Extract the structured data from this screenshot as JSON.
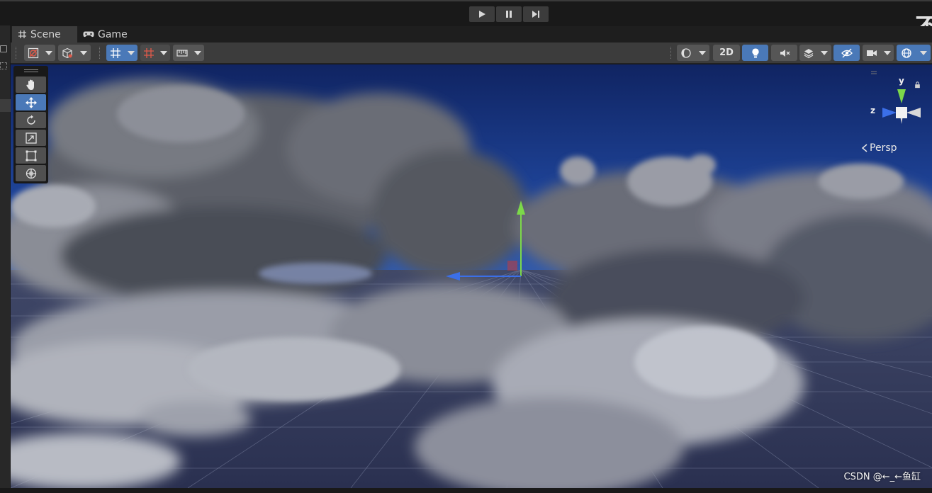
{
  "tabs": [
    {
      "label": "Scene",
      "icon": "grid-icon",
      "active": true
    },
    {
      "label": "Game",
      "icon": "gamepad-icon",
      "active": false
    }
  ],
  "playbar": {
    "buttons": [
      "play-icon",
      "pause-icon",
      "step-icon"
    ],
    "corner_glyph": "不"
  },
  "toolbar": {
    "left_tools": [
      "draw-mode-icon",
      "shading-cube-icon",
      "grid-snap-icon",
      "increment-snap-icon",
      "ruler-icon"
    ],
    "right_tools": [
      "render-mode-icon",
      "lighting-bulb-icon",
      "audio-mute-icon",
      "effects-icon",
      "hidden-objects-icon",
      "camera-icon",
      "gizmos-icon"
    ],
    "mode_2d_label": "2D"
  },
  "tools": [
    "hand-icon",
    "move-icon",
    "rotate-icon",
    "scale-icon",
    "rect-icon",
    "transform-icon"
  ],
  "gizmo": {
    "y_label": "y",
    "z_label": "z",
    "projection_label": "Persp",
    "lock_icon": "lock-icon"
  },
  "watermark": "CSDN @←_←鱼缸",
  "colors": {
    "accent": "#4a79b8",
    "axis_y": "#7cd94a",
    "axis_z": "#3b6fe8",
    "sky": "#1c3a8a"
  }
}
